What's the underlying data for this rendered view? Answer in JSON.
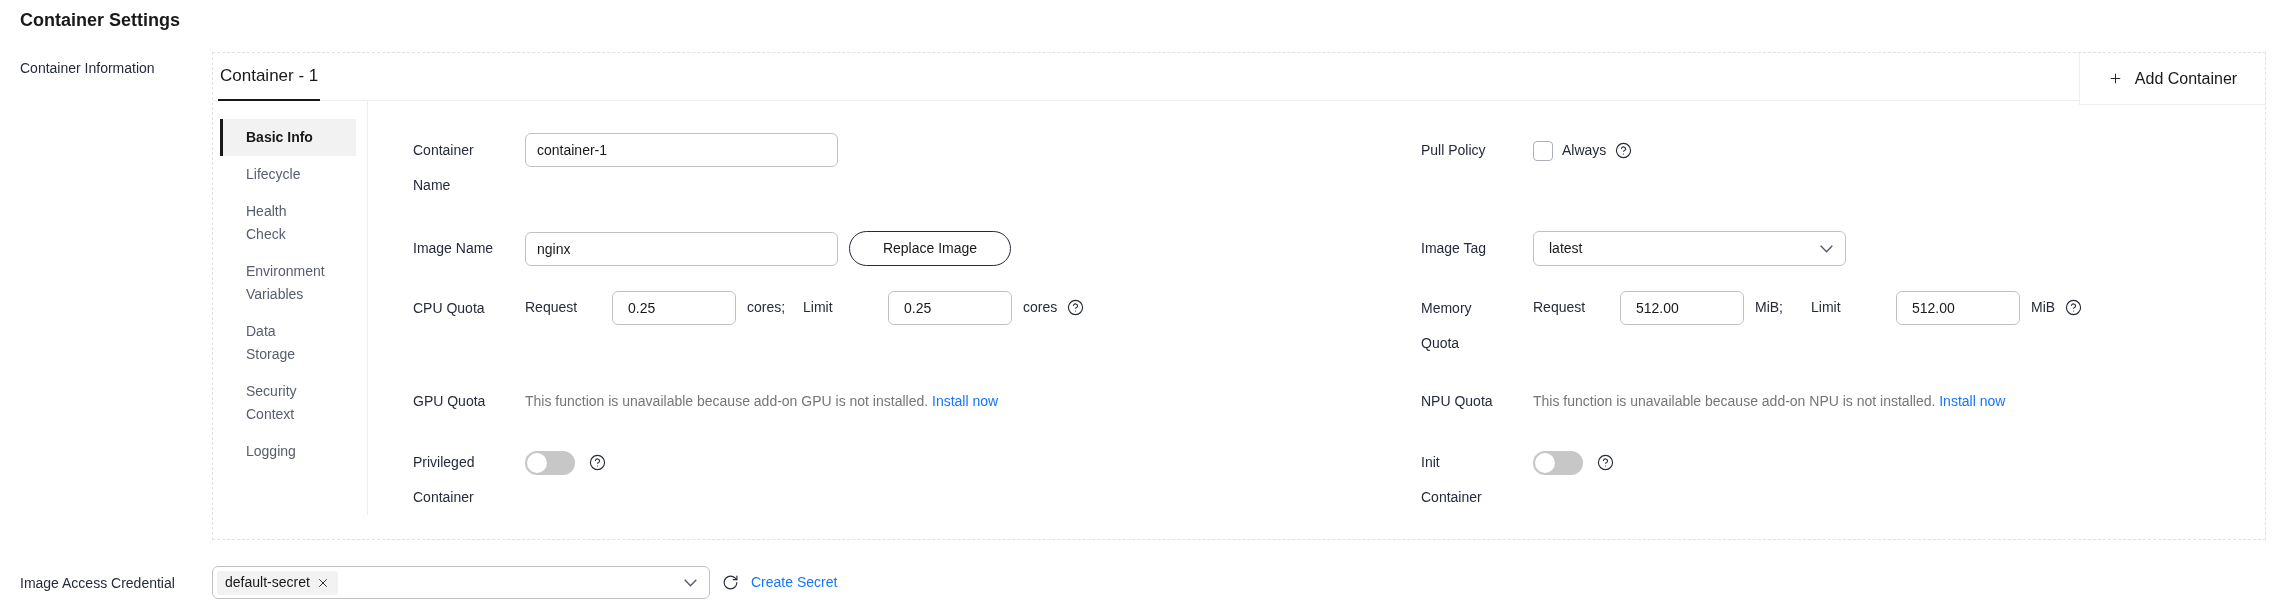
{
  "title": "Container Settings",
  "section_label": "Container Information",
  "container_tabs": [
    {
      "label": "Container - 1",
      "selected": true
    }
  ],
  "add_container_button": "Add Container",
  "side_nav": [
    {
      "label": "Basic Info",
      "selected": true
    },
    {
      "label": "Lifecycle",
      "selected": false
    },
    {
      "label": "Health Check",
      "selected": false
    },
    {
      "label": "Environment Variables",
      "selected": false
    },
    {
      "label": "Data Storage",
      "selected": false
    },
    {
      "label": "Security Context",
      "selected": false
    },
    {
      "label": "Logging",
      "selected": false
    }
  ],
  "form_rows": [
    {
      "left": {
        "kind": "input",
        "label": "Container Name",
        "value": "container-1"
      },
      "right": {
        "kind": "checkbox",
        "label": "Pull Policy",
        "option": "Always",
        "checked": false,
        "help": true
      }
    },
    {
      "left": {
        "kind": "input_button",
        "label": "Image Name",
        "value": "nginx",
        "button": "Replace Image"
      },
      "right": {
        "kind": "select",
        "label": "Image Tag",
        "value": "latest"
      }
    },
    {
      "left": {
        "kind": "quota",
        "label": "CPU Quota",
        "request_label": "Request",
        "request_value": "0.25",
        "request_unit": "cores;",
        "limit_label": "Limit",
        "limit_value": "0.25",
        "limit_unit": "cores",
        "help": true
      },
      "right": {
        "kind": "quota",
        "label": "Memory Quota",
        "request_label": "Request",
        "request_value": "512.00",
        "request_unit": "MiB;",
        "limit_label": "Limit",
        "limit_value": "512.00",
        "limit_unit": "MiB",
        "help": true
      }
    },
    {
      "left": {
        "kind": "notice",
        "label": "GPU Quota",
        "text": "This function is unavailable because add-on GPU is not installed.",
        "link": "Install now"
      },
      "right": {
        "kind": "notice",
        "label": "NPU Quota",
        "text": "This function is unavailable because add-on NPU is not installed.",
        "link": "Install now"
      }
    },
    {
      "left": {
        "kind": "toggle",
        "label": "Privileged Container",
        "on": false,
        "help": true
      },
      "right": {
        "kind": "toggle",
        "label": "Init Container",
        "on": false,
        "help": true
      }
    }
  ],
  "credential": {
    "label": "Image Access Credential",
    "tags": [
      "default-secret"
    ],
    "create_link": "Create Secret"
  }
}
